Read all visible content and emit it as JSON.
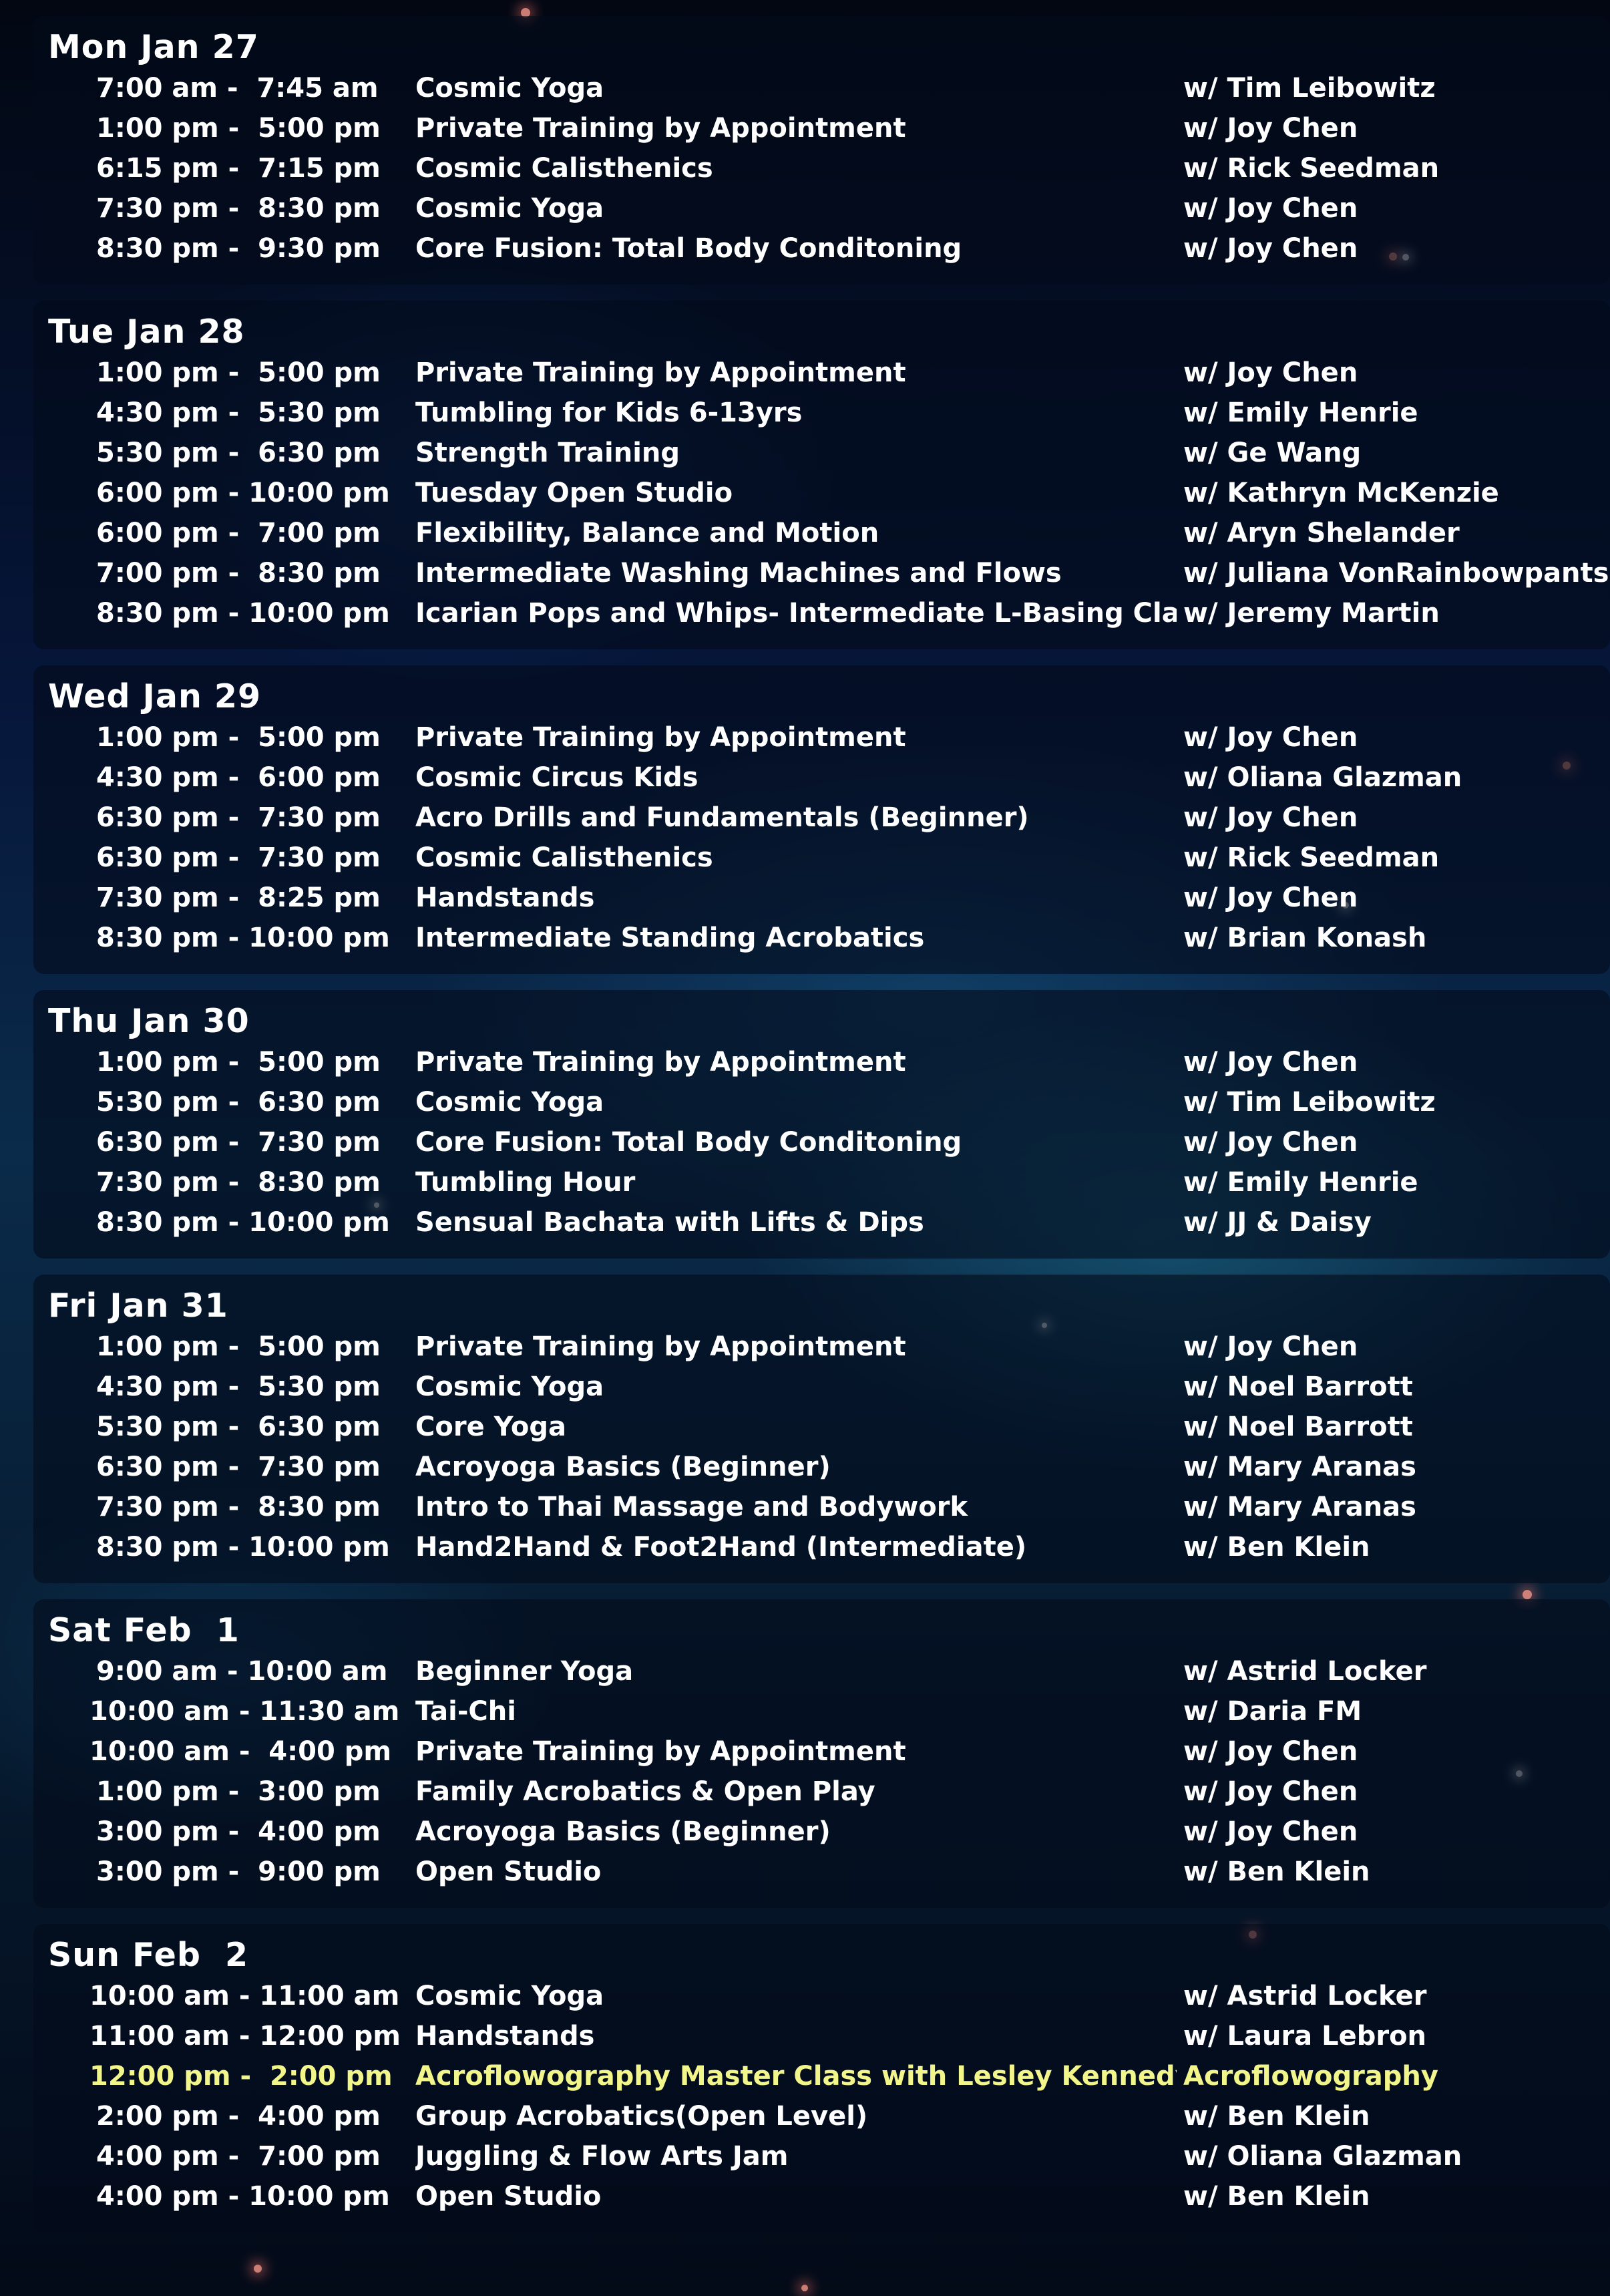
{
  "days": [
    {
      "title": "Mon Jan 27",
      "rows": [
        {
          "time": "7:00 am -  7:45 am",
          "class": "Cosmic Yoga",
          "instructor": "w/ Tim Leibowitz"
        },
        {
          "time": "1:00 pm -  5:00 pm",
          "class": "Private Training by Appointment",
          "instructor": "w/ Joy Chen"
        },
        {
          "time": "6:15 pm -  7:15 pm",
          "class": "Cosmic Calisthenics",
          "instructor": "w/ Rick Seedman"
        },
        {
          "time": "7:30 pm -  8:30 pm",
          "class": "Cosmic Yoga",
          "instructor": "w/ Joy Chen"
        },
        {
          "time": "8:30 pm -  9:30 pm",
          "class": "Core Fusion: Total Body Conditoning",
          "instructor": "w/ Joy Chen"
        }
      ]
    },
    {
      "title": "Tue Jan 28",
      "rows": [
        {
          "time": "1:00 pm -  5:00 pm",
          "class": "Private Training by Appointment",
          "instructor": "w/ Joy Chen"
        },
        {
          "time": "4:30 pm -  5:30 pm",
          "class": "Tumbling for Kids 6-13yrs",
          "instructor": "w/ Emily Henrie"
        },
        {
          "time": "5:30 pm -  6:30 pm",
          "class": "Strength Training",
          "instructor": "w/ Ge Wang"
        },
        {
          "time": "6:00 pm - 10:00 pm",
          "class": "Tuesday Open Studio",
          "instructor": "w/ Kathryn McKenzie"
        },
        {
          "time": "6:00 pm -  7:00 pm",
          "class": "Flexibility, Balance and Motion",
          "instructor": "w/ Aryn Shelander"
        },
        {
          "time": "7:00 pm -  8:30 pm",
          "class": "Intermediate Washing Machines and Flows",
          "instructor": "w/ Juliana VonRainbowpants"
        },
        {
          "time": "8:30 pm - 10:00 pm",
          "class": "Icarian Pops and Whips- Intermediate L-Basing Class",
          "instructor": "w/ Jeremy Martin"
        }
      ]
    },
    {
      "title": "Wed Jan 29",
      "rows": [
        {
          "time": "1:00 pm -  5:00 pm",
          "class": "Private Training by Appointment",
          "instructor": "w/ Joy Chen"
        },
        {
          "time": "4:30 pm -  6:00 pm",
          "class": "Cosmic Circus Kids",
          "instructor": "w/ Oliana Glazman"
        },
        {
          "time": "6:30 pm -  7:30 pm",
          "class": "Acro Drills and Fundamentals (Beginner)",
          "instructor": "w/ Joy Chen"
        },
        {
          "time": "6:30 pm -  7:30 pm",
          "class": "Cosmic Calisthenics",
          "instructor": "w/ Rick Seedman"
        },
        {
          "time": "7:30 pm -  8:25 pm",
          "class": "Handstands",
          "instructor": "w/ Joy Chen"
        },
        {
          "time": "8:30 pm - 10:00 pm",
          "class": "Intermediate Standing Acrobatics",
          "instructor": "w/ Brian Konash"
        }
      ]
    },
    {
      "title": "Thu Jan 30",
      "rows": [
        {
          "time": "1:00 pm -  5:00 pm",
          "class": "Private Training by Appointment",
          "instructor": "w/ Joy Chen"
        },
        {
          "time": "5:30 pm -  6:30 pm",
          "class": "Cosmic Yoga",
          "instructor": "w/ Tim Leibowitz"
        },
        {
          "time": "6:30 pm -  7:30 pm",
          "class": "Core Fusion: Total Body Conditoning",
          "instructor": "w/ Joy Chen"
        },
        {
          "time": "7:30 pm -  8:30 pm",
          "class": "Tumbling Hour",
          "instructor": "w/ Emily Henrie"
        },
        {
          "time": "8:30 pm - 10:00 pm",
          "class": "Sensual Bachata with Lifts & Dips",
          "instructor": "w/ JJ & Daisy"
        }
      ]
    },
    {
      "title": "Fri Jan 31",
      "rows": [
        {
          "time": "1:00 pm -  5:00 pm",
          "class": "Private Training by Appointment",
          "instructor": "w/ Joy Chen"
        },
        {
          "time": "4:30 pm -  5:30 pm",
          "class": "Cosmic Yoga",
          "instructor": "w/ Noel Barrott"
        },
        {
          "time": "5:30 pm -  6:30 pm",
          "class": "Core Yoga",
          "instructor": "w/ Noel Barrott"
        },
        {
          "time": "6:30 pm -  7:30 pm",
          "class": "Acroyoga Basics (Beginner)",
          "instructor": "w/ Mary Aranas"
        },
        {
          "time": "7:30 pm -  8:30 pm",
          "class": "Intro to Thai Massage and Bodywork",
          "instructor": "w/ Mary Aranas"
        },
        {
          "time": "8:30 pm - 10:00 pm",
          "class": "Hand2Hand & Foot2Hand (Intermediate)",
          "instructor": "w/ Ben Klein"
        }
      ]
    },
    {
      "title": "Sat Feb  1",
      "rows": [
        {
          "time": "9:00 am - 10:00 am",
          "class": "Beginner Yoga",
          "instructor": "w/ Astrid Locker"
        },
        {
          "time": "10:00 am - 11:30 am",
          "class": "Tai-Chi",
          "instructor": "w/ Daria FM"
        },
        {
          "time": "10:00 am -  4:00 pm",
          "class": "Private Training by Appointment",
          "instructor": "w/ Joy Chen"
        },
        {
          "time": "1:00 pm -  3:00 pm",
          "class": "Family Acrobatics & Open Play",
          "instructor": "w/ Joy Chen"
        },
        {
          "time": "3:00 pm -  4:00 pm",
          "class": "Acroyoga Basics (Beginner)",
          "instructor": "w/ Joy Chen"
        },
        {
          "time": "3:00 pm -  9:00 pm",
          "class": "Open Studio",
          "instructor": "w/ Ben Klein"
        }
      ]
    },
    {
      "title": "Sun Feb  2",
      "rows": [
        {
          "time": "10:00 am - 11:00 am",
          "class": "Cosmic Yoga",
          "instructor": "w/ Astrid Locker"
        },
        {
          "time": "11:00 am - 12:00 pm",
          "class": "Handstands",
          "instructor": "w/ Laura Lebron"
        },
        {
          "time": "12:00 pm -  2:00 pm",
          "class": "Acroflowography Master Class with Lesley Kennedy and ...",
          "instructor": "Acroflowography",
          "highlight": true
        },
        {
          "time": "2:00 pm -  4:00 pm",
          "class": "Group Acrobatics(Open Level)",
          "instructor": "w/ Ben Klein"
        },
        {
          "time": "4:00 pm -  7:00 pm",
          "class": "Juggling & Flow Arts Jam",
          "instructor": "w/ Oliana Glazman"
        },
        {
          "time": "4:00 pm - 10:00 pm",
          "class": "Open Studio",
          "instructor": "w/ Ben Klein"
        }
      ]
    }
  ],
  "colors": {
    "text": "#ffffff",
    "highlight": "#f2f58a",
    "panel": "rgba(4,12,28,0.62)"
  }
}
